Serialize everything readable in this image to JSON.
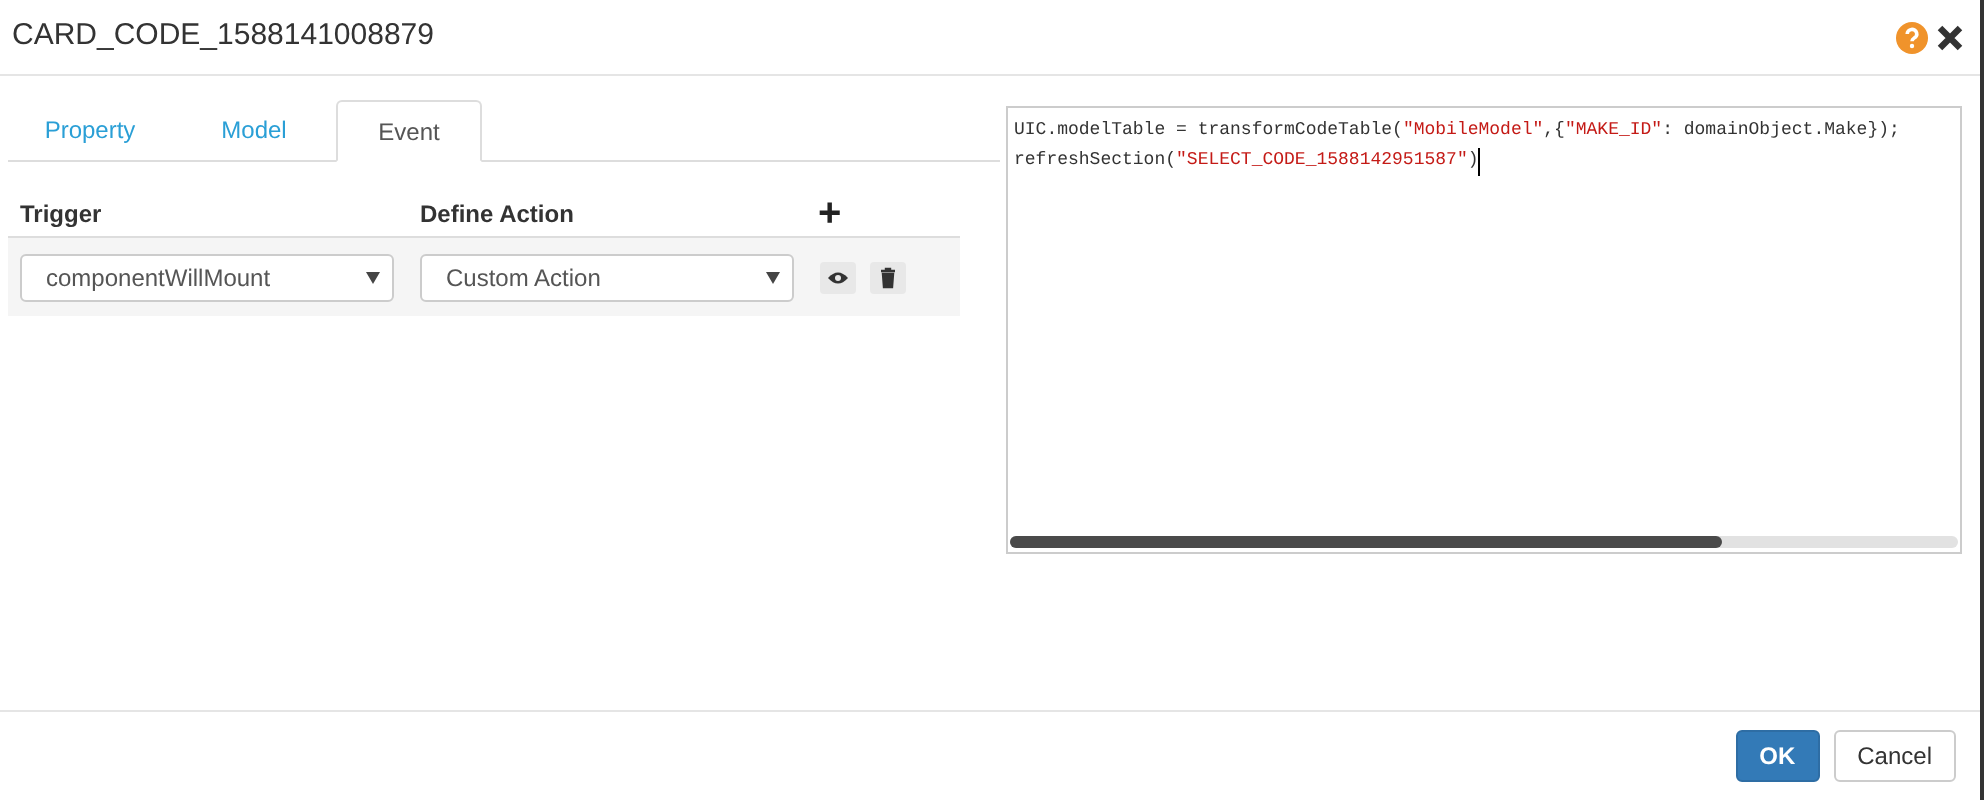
{
  "dialog": {
    "title": "CARD_CODE_1588141008879"
  },
  "tabs": [
    {
      "label": "Property",
      "selected": false
    },
    {
      "label": "Model",
      "selected": false
    },
    {
      "label": "Event",
      "selected": true
    }
  ],
  "events_table": {
    "columns": [
      "Trigger",
      "Define Action"
    ],
    "add_button": "+",
    "rows": [
      {
        "trigger": "componentWillMount",
        "action": "Custom Action"
      }
    ]
  },
  "code_editor": {
    "lines": [
      [
        {
          "kind": "plain",
          "text": "UIC.modelTable = transformCodeTable("
        },
        {
          "kind": "string",
          "text": "\"MobileModel\""
        },
        {
          "kind": "plain",
          "text": ",{"
        },
        {
          "kind": "string",
          "text": "\"MAKE_ID\""
        },
        {
          "kind": "plain",
          "text": ": domainObject.Make});"
        }
      ],
      [
        {
          "kind": "plain",
          "text": "refreshSection("
        },
        {
          "kind": "string",
          "text": "\"SELECT_CODE_1588142951587\""
        },
        {
          "kind": "plain",
          "text": ")"
        }
      ]
    ]
  },
  "buttons": [
    {
      "label": "OK",
      "kind": "primary"
    },
    {
      "label": "Cancel",
      "kind": "default"
    }
  ]
}
